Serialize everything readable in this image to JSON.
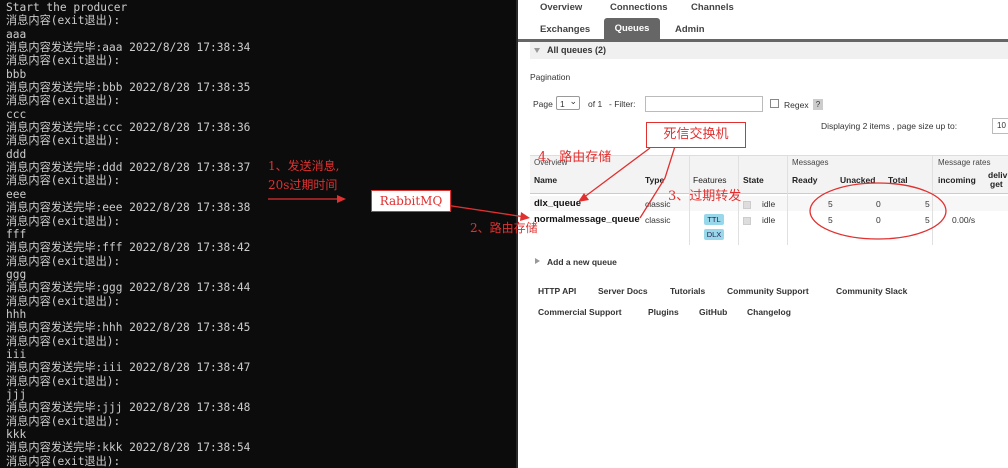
{
  "terminal": {
    "lines": [
      "Start the producer",
      "消息内容(exit退出):",
      "aaa",
      "消息内容发送完毕:aaa 2022/8/28 17:38:34",
      "消息内容(exit退出):",
      "bbb",
      "消息内容发送完毕:bbb 2022/8/28 17:38:35",
      "消息内容(exit退出):",
      "ccc",
      "消息内容发送完毕:ccc 2022/8/28 17:38:36",
      "消息内容(exit退出):",
      "ddd",
      "消息内容发送完毕:ddd 2022/8/28 17:38:37",
      "消息内容(exit退出):",
      "eee",
      "消息内容发送完毕:eee 2022/8/28 17:38:38",
      "消息内容(exit退出):",
      "fff",
      "消息内容发送完毕:fff 2022/8/28 17:38:42",
      "消息内容(exit退出):",
      "ggg",
      "消息内容发送完毕:ggg 2022/8/28 17:38:44",
      "消息内容(exit退出):",
      "hhh",
      "消息内容发送完毕:hhh 2022/8/28 17:38:45",
      "消息内容(exit退出):",
      "iii",
      "消息内容发送完毕:iii 2022/8/28 17:38:47",
      "消息内容(exit退出):",
      "jjj",
      "消息内容发送完毕:jjj 2022/8/28 17:38:48",
      "消息内容(exit退出):",
      "kkk",
      "消息内容发送完毕:kkk 2022/8/28 17:38:54",
      "消息内容(exit退出):"
    ]
  },
  "nav": {
    "overview": "Overview",
    "connections": "Connections",
    "channels": "Channels",
    "exchanges": "Exchanges",
    "queues": "Queues",
    "admin": "Admin"
  },
  "queues": {
    "section_title": "All queues (2)",
    "pagination_label": "Pagination",
    "page_label": "Page",
    "page_value": "1",
    "of_label": "of 1",
    "filter_label": "- Filter:",
    "filter_value": "",
    "regex_label": "Regex",
    "help_label": "?",
    "displaying": "Displaying 2 items , page size up to:",
    "page_size": "10",
    "group_overview": "Overview",
    "group_messages": "Messages",
    "group_rates": "Message rates",
    "columns": {
      "name": "Name",
      "type": "Type",
      "features": "Features",
      "state": "State",
      "ready": "Ready",
      "unacked": "Unacked",
      "total": "Total",
      "incoming": "incoming",
      "deliver": "deliv",
      "deliver2": "get"
    },
    "rows": [
      {
        "name": "dlx_queue",
        "type": "classic",
        "features": [],
        "state": "idle",
        "ready": "5",
        "unacked": "0",
        "total": "5",
        "incoming": ""
      },
      {
        "name": "normalmessage_queue",
        "type": "classic",
        "features": [
          "TTL",
          "DLX"
        ],
        "state": "idle",
        "ready": "5",
        "unacked": "0",
        "total": "5",
        "incoming": "0.00/s"
      }
    ],
    "add_queue": "Add a new queue"
  },
  "footer_links": [
    "HTTP API",
    "Server Docs",
    "Tutorials",
    "Community Support",
    "Community Slack",
    "Commercial Support",
    "Plugins",
    "GitHub",
    "Changelog"
  ],
  "annotations": {
    "send_msg_1": "1、发送消息,",
    "send_msg_2": "20s过期时间",
    "rabbitmq": "RabbitMQ",
    "route_store_2": "2、路由存储",
    "dead_exchange": "死信交换机",
    "expire_forward": "3、过期转发",
    "route_store_4": "4、路由存储"
  },
  "colors": {
    "terminal_bg": "#0c0c0c",
    "terminal_fg": "#cccccc",
    "annotation_red": "#e03030",
    "tag_blue": "#99d8ea",
    "tab_active": "#666666"
  }
}
